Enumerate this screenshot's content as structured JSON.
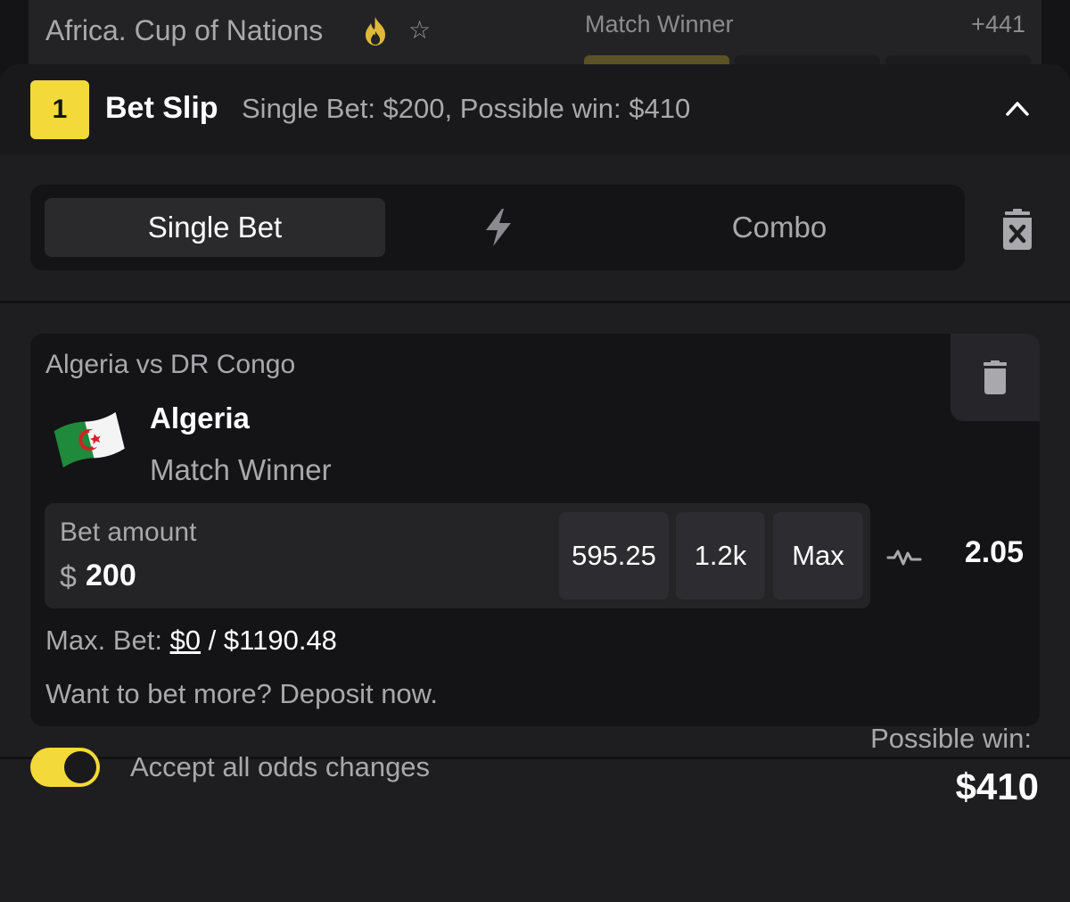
{
  "background_event": {
    "title": "Africa. Cup of Nations",
    "market": "Match Winner",
    "more_markets": "+441"
  },
  "bet_slip": {
    "count": "1",
    "title": "Bet Slip",
    "summary": "Single Bet: $200, Possible win: $410",
    "tabs": {
      "single": "Single Bet",
      "combo": "Combo"
    },
    "bet": {
      "match": "Algeria vs DR Congo",
      "selection": "Algeria",
      "market": "Match Winner",
      "amount_label": "Bet amount",
      "currency": "$",
      "amount": "200",
      "quick_amounts": [
        "595.25",
        "1.2k",
        "Max"
      ],
      "odds": "2.05",
      "max_bet_prefix": "Max. Bet:",
      "max_bet_current": "$0",
      "max_bet_sep": "/",
      "max_bet_limit": "$1190.48",
      "deposit_text": "Want to bet more? Deposit now."
    },
    "accept_odds_label": "Accept all odds changes",
    "accept_odds_enabled": true,
    "possible_win_label": "Possible win:",
    "possible_win_value": "$410"
  },
  "colors": {
    "accent": "#f3d93a",
    "background": "#1e1e20",
    "card": "#141416",
    "muted_text": "#a8a8ad"
  },
  "icons": {
    "hot": "fire-icon",
    "favorite": "star-icon",
    "collapse": "chevron-up-icon",
    "bolt": "lightning-icon",
    "clear_all": "trash-x-icon",
    "remove": "trash-icon",
    "flag": "algeria-flag-icon",
    "trend": "odds-trend-icon"
  }
}
